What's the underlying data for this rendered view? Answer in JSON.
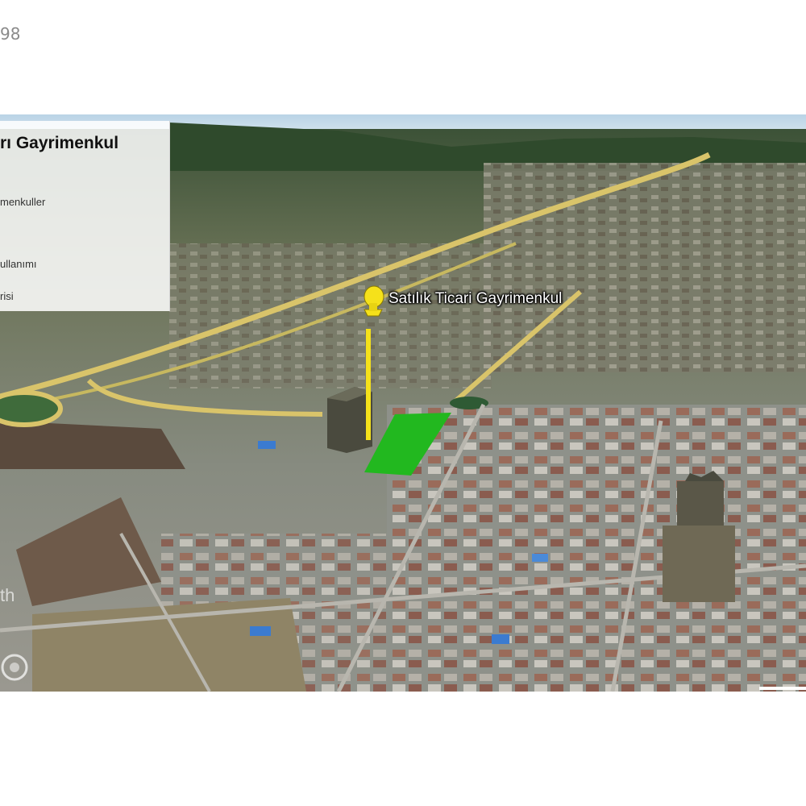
{
  "listing": {
    "id_fragment": "98"
  },
  "info_panel": {
    "title": "rı Gayrimenkul",
    "lines": [
      "menkuller",
      "ullanımı",
      "risi"
    ]
  },
  "placemark": {
    "label": "Satılık Ticari Gayrimenkul",
    "pin_color": "#f5e11a"
  },
  "map": {
    "watermark": "th",
    "parcel_color": "#22b81f",
    "road_color": "#d9c46a"
  }
}
